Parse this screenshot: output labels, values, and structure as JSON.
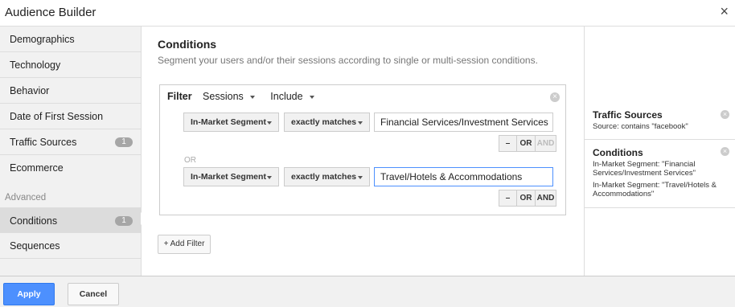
{
  "window": {
    "title": "Audience Builder",
    "close_glyph": "×"
  },
  "sidebar": {
    "items": [
      {
        "label": "Demographics"
      },
      {
        "label": "Technology"
      },
      {
        "label": "Behavior"
      },
      {
        "label": "Date of First Session"
      },
      {
        "label": "Traffic Sources",
        "badge": "1"
      },
      {
        "label": "Ecommerce"
      }
    ],
    "section_label": "Advanced",
    "advanced_items": [
      {
        "label": "Conditions",
        "badge": "1",
        "active": true
      },
      {
        "label": "Sequences"
      }
    ]
  },
  "main": {
    "title": "Conditions",
    "subtitle": "Segment your users and/or their sessions according to single or multi-session conditions.",
    "filter": {
      "label": "Filter",
      "scope": "Sessions",
      "mode": "Include",
      "remove_glyph": "×",
      "or_separator": "OR",
      "rows": [
        {
          "dimension": "In-Market Segment",
          "operator": "exactly matches",
          "value": "Financial Services/Investment Services",
          "buttons": {
            "minus": "–",
            "or": "OR",
            "and": "AND"
          }
        },
        {
          "dimension": "In-Market Segment",
          "operator": "exactly matches",
          "value": "Travel/Hotels & Accommodations",
          "buttons": {
            "minus": "–",
            "or": "OR",
            "and": "AND"
          }
        }
      ]
    },
    "add_filter_label": "+ Add Filter"
  },
  "summary": {
    "cards": [
      {
        "title": "Traffic Sources",
        "lines": [
          "Source: contains \"facebook\""
        ]
      },
      {
        "title": "Conditions",
        "lines": [
          "In-Market Segment: \"Financial Services/Investment Services\"",
          "In-Market Segment: \"Travel/Hotels & Accommodations\""
        ]
      }
    ],
    "remove_glyph": "×"
  },
  "footer": {
    "apply_label": "Apply",
    "cancel_label": "Cancel"
  },
  "colors": {
    "accent": "#4d90fe",
    "sidebar_bg": "#f1f1f1",
    "active_bg": "#dcdcdc",
    "badge": "#a6a6a6"
  }
}
